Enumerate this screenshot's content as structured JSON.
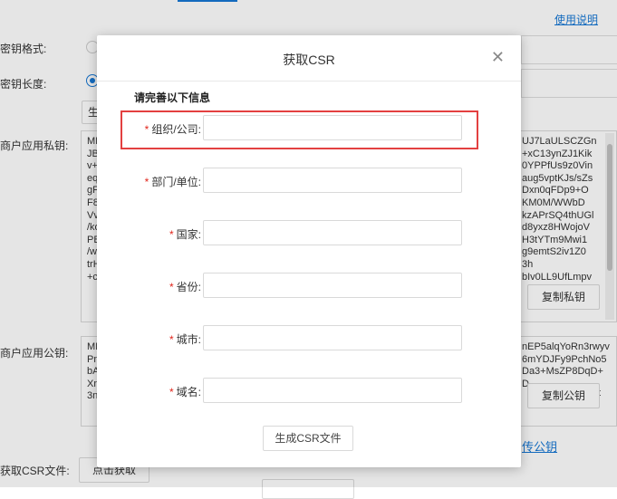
{
  "background": {
    "help_link": "使用说明",
    "key_format_label": "密钥格式:",
    "key_length_label": "密钥长度:",
    "private_key_label": "商户应用私钥:",
    "public_key_label": "商户应用公钥:",
    "csr_file_label": "获取CSR文件:",
    "csr_click_button": "点击获取",
    "generate_partial": "生",
    "private_key_left": [
      "MI",
      "JB",
      "v+",
      "eq",
      "gF",
      "F8",
      "Vv",
      "/ko",
      "PB",
      "/w",
      "trH",
      "+c"
    ],
    "private_key_right": [
      "UJ7LaULSCZGn",
      "+xC13ynZJ1Kik",
      "0YPPfUs9z0Vin",
      "aug5vptKJs/sZs",
      "Dxn0qFDp9+O",
      "KM0M/WWbD",
      "kzAPrSQ4thUGl",
      "d8yxz8HWojoV",
      "H3tYTm9Mwi1",
      "g9emtS2iv1Z0",
      "3h",
      "bIv0LL9UfLmpv"
    ],
    "copy_private_button": "复制私钥",
    "public_key_left": [
      "MI",
      "Pn",
      "bA",
      "Xn",
      "3n"
    ],
    "public_key_right": [
      "nEP5alqYoRn3rwyv",
      "6mYDJFy9PchNo5",
      "Da3+MsZP8DqD+",
      "D",
      ""
    ],
    "copy_public_button": "复制公钥",
    "public_key_trailing": "t",
    "upload_public_link": "传公钥"
  },
  "modal": {
    "title": "获取CSR",
    "close_icon": "close-icon",
    "section_title": "请完善以下信息",
    "required_mark": "*",
    "fields": [
      {
        "label": "组织/公司:",
        "value": "",
        "highlighted": true
      },
      {
        "label": "部门/单位:",
        "value": ""
      },
      {
        "label": "国家:",
        "value": ""
      },
      {
        "label": "省份:",
        "value": ""
      },
      {
        "label": "城市:",
        "value": ""
      },
      {
        "label": "域名:",
        "value": ""
      }
    ],
    "generate_button": "生成CSR文件"
  },
  "colors": {
    "accent": "#1677d4",
    "required": "#e1251b",
    "highlight_border": "#e34040"
  }
}
